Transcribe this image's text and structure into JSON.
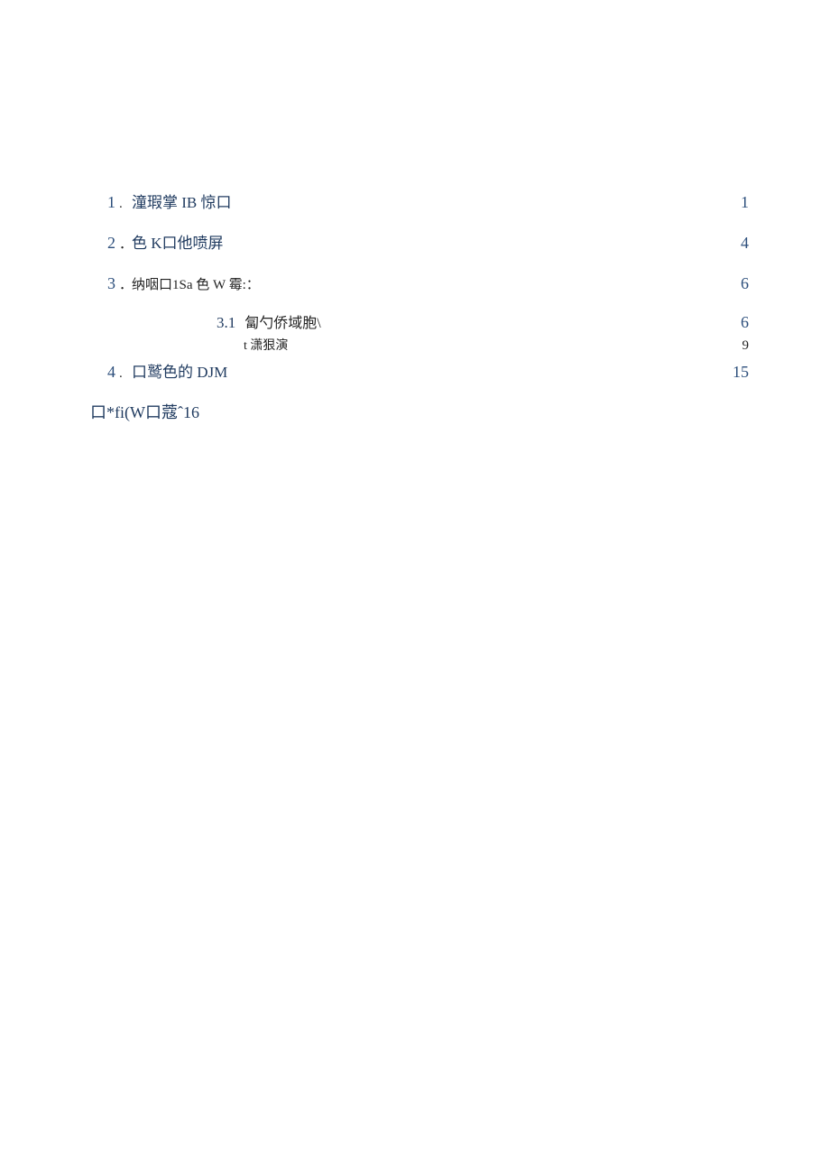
{
  "toc": {
    "entries": [
      {
        "num": "1",
        "sep": ".",
        "label": "潼瑕掌 IB 惊口",
        "page": "1"
      },
      {
        "num": "2",
        "sep": "．",
        "label": "色 K口他喷屏",
        "page": "4"
      },
      {
        "num": "3",
        "sep": "．",
        "label": "纳咽口1Sa 色 W 霉:：",
        "page": "6"
      }
    ],
    "sub1": {
      "num": "3.1",
      "label": "匐勺侨域胞\\",
      "page": "6"
    },
    "sub2": {
      "label": "t 潇狠演",
      "page": "9"
    },
    "entry4": {
      "num": "4",
      "sep": ".",
      "label": "口鹫色的 DJM",
      "page": "15"
    },
    "footer": "口*fi(W口蔻ˆ16"
  }
}
